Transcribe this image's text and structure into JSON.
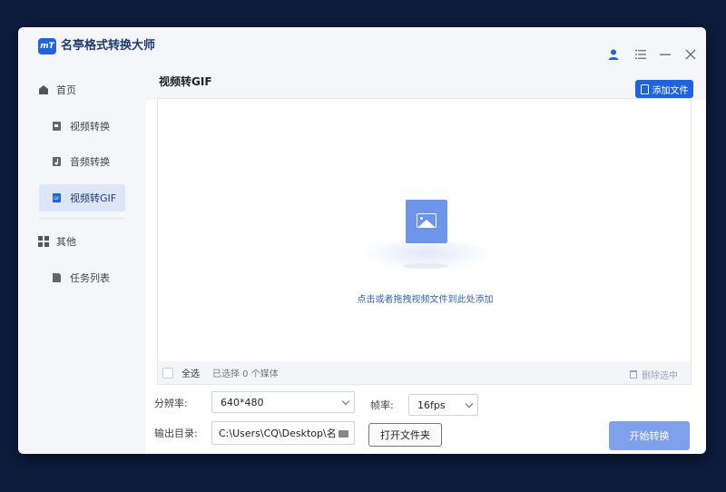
{
  "app": {
    "logo_text": "mT",
    "title": "名亭格式转换大师"
  },
  "sidebar": {
    "items": [
      {
        "label": "首页"
      },
      {
        "label": "视频转换"
      },
      {
        "label": "音频转换"
      },
      {
        "label": "视频转GIF"
      },
      {
        "label": "其他"
      },
      {
        "label": "任务列表"
      }
    ]
  },
  "main": {
    "title": "视频转GIF",
    "add_file_label": "添加文件",
    "drop_hint": "点击或者拖拽视频文件到此处添加",
    "select_all_label": "全选",
    "selected_count_text": "已选择 0 个媒体",
    "delete_selected_label": "删除选中"
  },
  "settings": {
    "resolution_label": "分辨率:",
    "resolution_value": "640*480",
    "fps_label": "帧率:",
    "fps_value": "16fps",
    "output_label": "输出目录:",
    "output_value": "C:\\Users\\CQ\\Desktop\\名",
    "open_folder_label": "打开文件夹",
    "start_label": "开始转换"
  },
  "colors": {
    "accent": "#1e63e6",
    "start_button": "#7fa0ea",
    "sidebar_bg": "#f4f6f9"
  }
}
